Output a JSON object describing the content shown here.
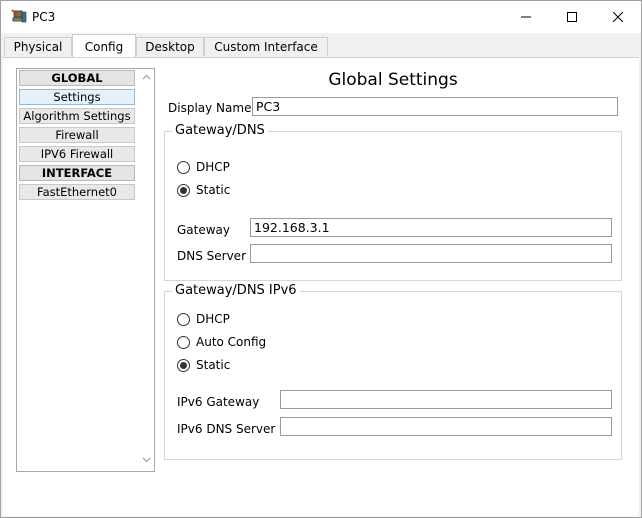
{
  "window": {
    "title": "PC3"
  },
  "tabs": [
    {
      "label": "Physical"
    },
    {
      "label": "Config"
    },
    {
      "label": "Desktop"
    },
    {
      "label": "Custom Interface"
    }
  ],
  "active_tab": "Config",
  "sidebar": {
    "items": [
      {
        "label": "GLOBAL"
      },
      {
        "label": "Settings"
      },
      {
        "label": "Algorithm Settings"
      },
      {
        "label": "Firewall"
      },
      {
        "label": "IPV6 Firewall"
      },
      {
        "label": "INTERFACE"
      },
      {
        "label": "FastEthernet0"
      }
    ]
  },
  "global_settings": {
    "heading": "Global Settings",
    "display_name_label": "Display Name",
    "display_name_value": "PC3",
    "gateway_dns": {
      "legend": "Gateway/DNS",
      "dhcp_label": "DHCP",
      "static_label": "Static",
      "selected": "Static",
      "gateway_label": "Gateway",
      "gateway_value": "192.168.3.1",
      "dns_label": "DNS Server",
      "dns_value": ""
    },
    "gateway_dns_ipv6": {
      "legend": "Gateway/DNS IPv6",
      "dhcp_label": "DHCP",
      "auto_label": "Auto Config",
      "static_label": "Static",
      "selected": "Static",
      "gateway_label": "IPv6 Gateway",
      "gateway_value": "",
      "dns_label": "IPv6 DNS Server",
      "dns_value": ""
    }
  }
}
